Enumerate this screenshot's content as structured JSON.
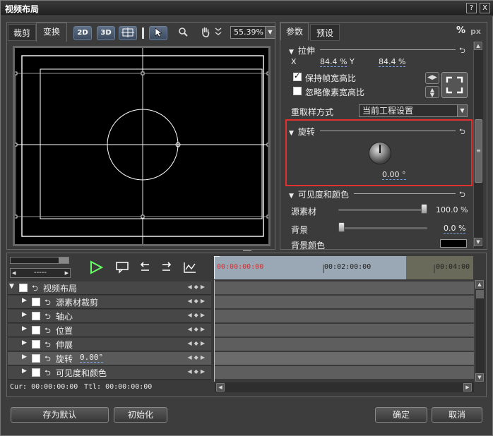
{
  "window": {
    "title": "视频布局",
    "help_label": "?",
    "close_label": "X"
  },
  "left_tabs": [
    "裁剪",
    "变换"
  ],
  "toolbar": {
    "btn_2d": "2D",
    "btn_3d": "3D",
    "zoom_value": "55.39%"
  },
  "right_tabs": [
    "参数",
    "预设"
  ],
  "units": {
    "percent": "%",
    "px": "px"
  },
  "stretch": {
    "title": "拉伸",
    "x_label": "X",
    "x_value": "84.4 %",
    "y_label": "Y",
    "y_value": "84.4 %",
    "keep_ratio": {
      "label": "保持帧宽高比",
      "checked": true
    },
    "ignore_pixel": {
      "label": "忽略像素宽高比",
      "checked": false
    }
  },
  "resample": {
    "label": "重取样方式",
    "value": "当前工程设置"
  },
  "rotation": {
    "title": "旋转",
    "value": "0.00 °"
  },
  "visibility": {
    "title": "可见度和颜色",
    "source_label": "源素材",
    "source_value": "100.0 %",
    "source_level": 1.0,
    "bg_label": "背景",
    "bg_value": "0.0 %",
    "bg_level": 0.0,
    "bg_color_label": "背景颜色",
    "bg_color": "#000000"
  },
  "timeline": {
    "ruler": [
      "00:00:00:00",
      "00:02:00:00",
      "00:04:00"
    ],
    "tracks": [
      {
        "label": "视频布局",
        "extra": ""
      },
      {
        "label": "源素材裁剪",
        "extra": ""
      },
      {
        "label": "轴心",
        "extra": ""
      },
      {
        "label": "位置",
        "extra": ""
      },
      {
        "label": "伸展",
        "extra": ""
      },
      {
        "label": "旋转",
        "extra": "0.00°"
      },
      {
        "label": "可见度和颜色",
        "extra": ""
      }
    ],
    "cur_label": "Cur: 00:00:00:00",
    "ttl_label": "Ttl: 00:00:00:00",
    "frame_field": "-----"
  },
  "footer": {
    "save_default": "存为默认",
    "init": "初始化",
    "ok": "确定",
    "cancel": "取消"
  }
}
